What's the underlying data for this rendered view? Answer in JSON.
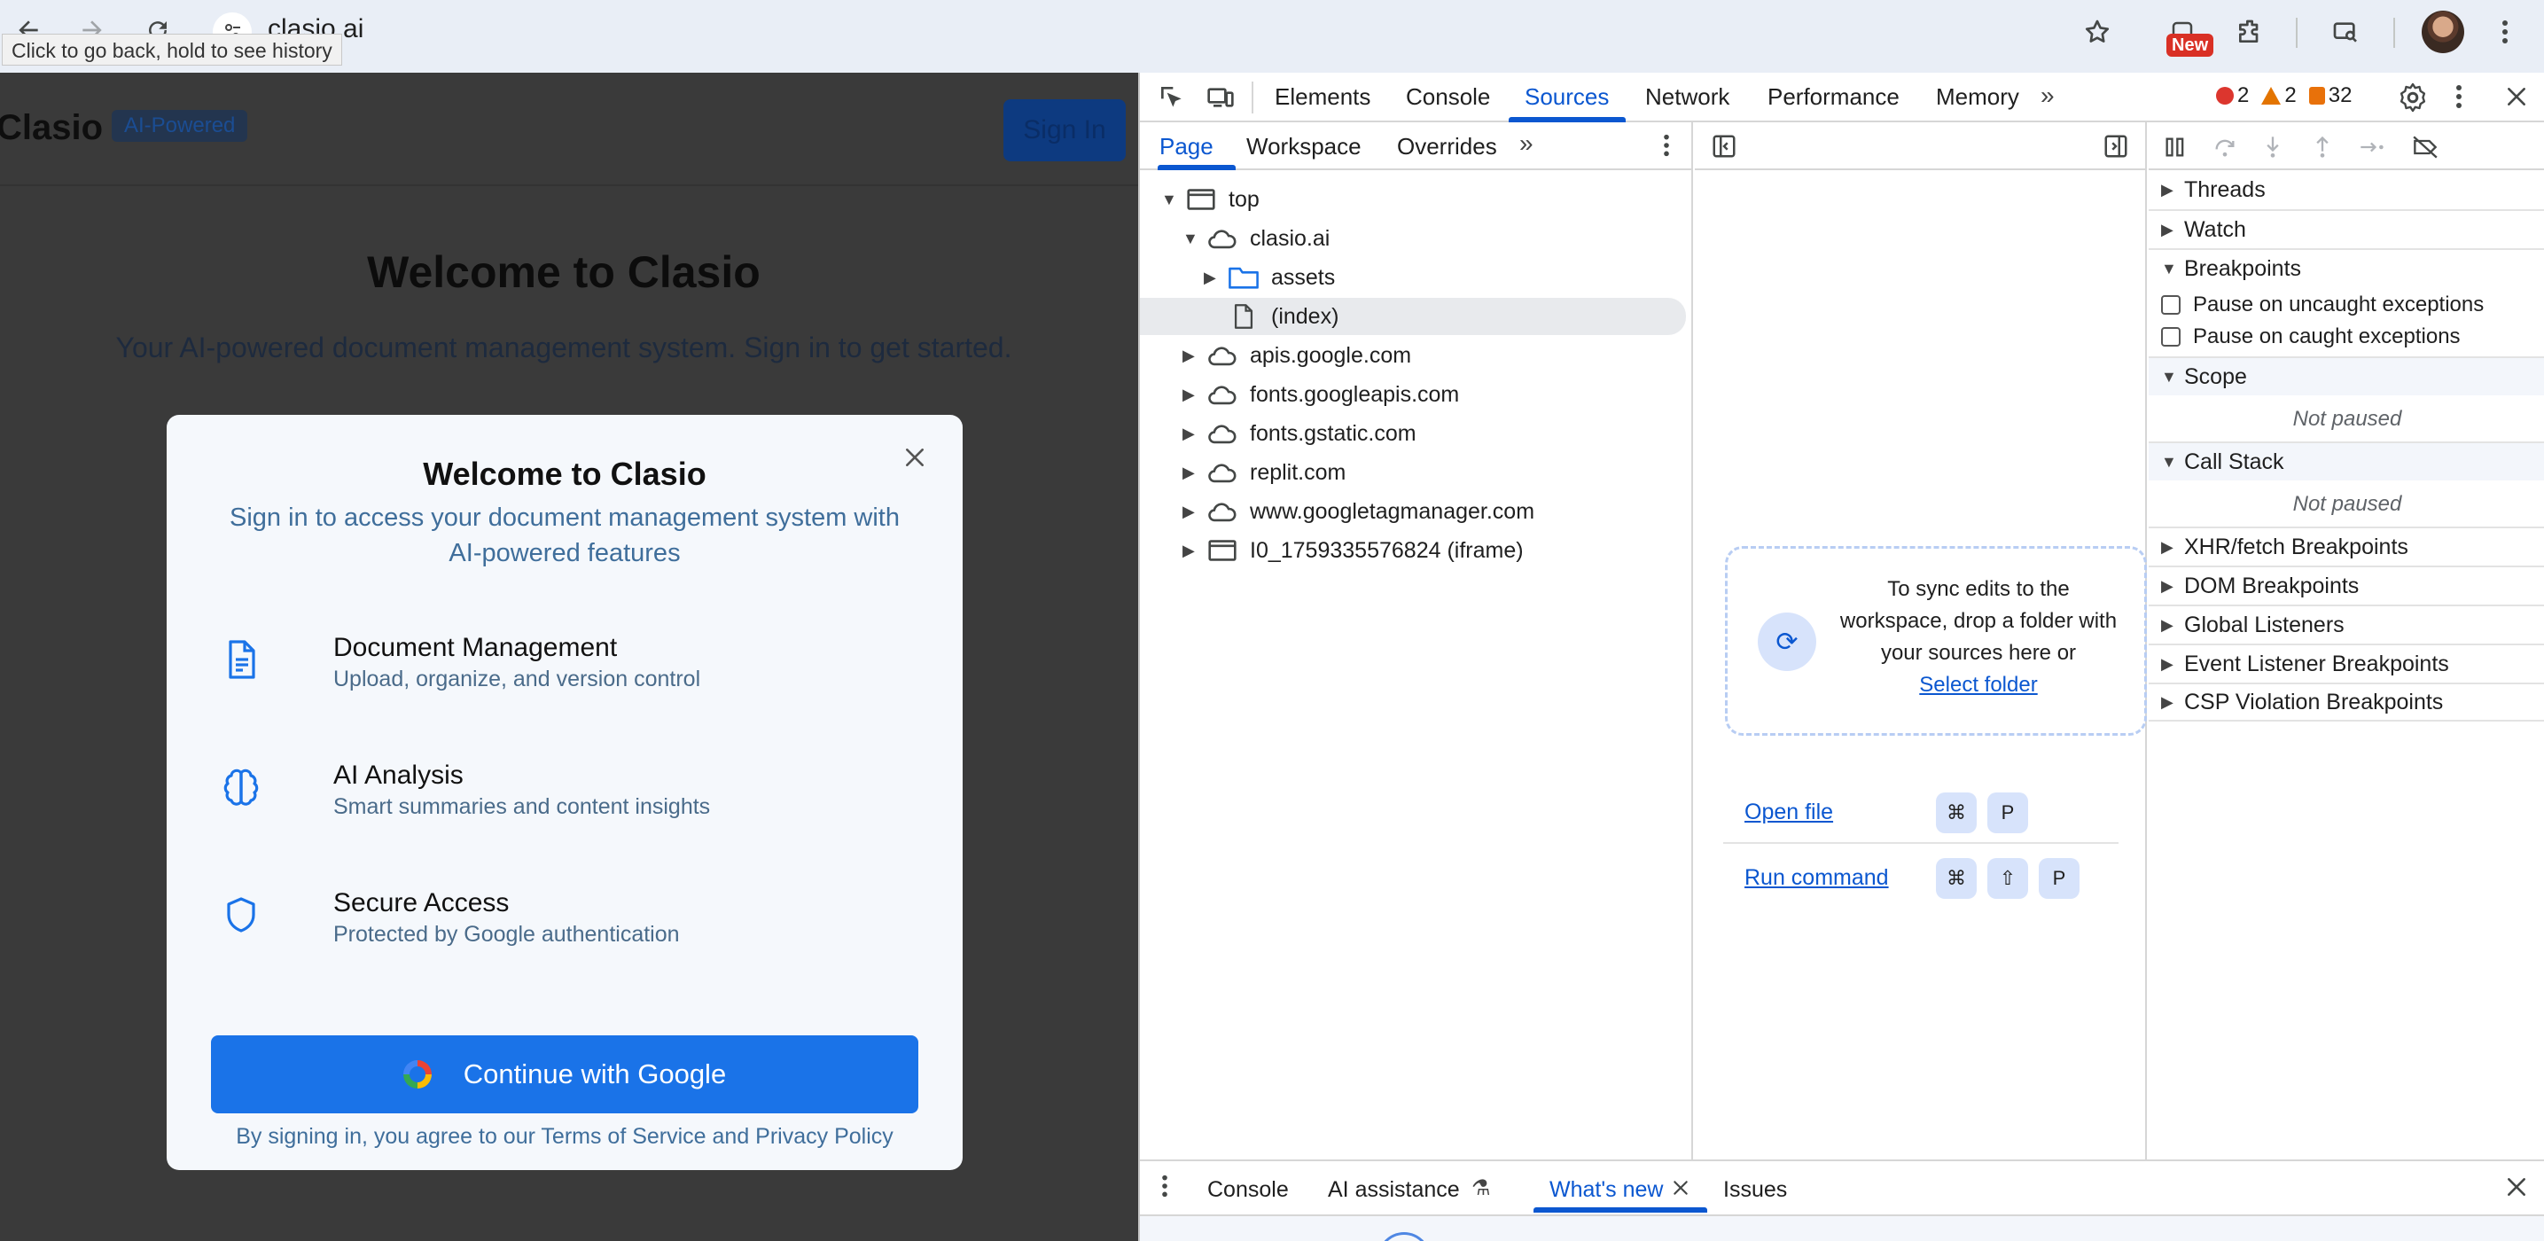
{
  "browser": {
    "url": "clasio.ai",
    "tooltip": "Click to go back, hold to see history",
    "new_badge": "New",
    "icons": [
      "back-arrow-icon",
      "forward-arrow-icon",
      "reload-icon",
      "site-info-icon",
      "bookmark-star-icon",
      "extensions-icon",
      "tab-search-icon",
      "profile-avatar",
      "kebab-menu-icon"
    ]
  },
  "page": {
    "brand": "Clasio",
    "brand_badge": "AI-Powered",
    "signin_button": "Sign In",
    "hero_title": "Welcome to Clasio",
    "hero_subtitle": "Your AI-powered document management system. Sign in to get started."
  },
  "modal": {
    "title": "Welcome to Clasio",
    "subtitle": "Sign in to access your document management system with AI-powered features",
    "features": [
      {
        "title": "Document Management",
        "desc": "Upload, organize, and version control",
        "icon": "document-icon"
      },
      {
        "title": "AI Analysis",
        "desc": "Smart summaries and content insights",
        "icon": "brain-icon"
      },
      {
        "title": "Secure Access",
        "desc": "Protected by Google authentication",
        "icon": "shield-icon"
      }
    ],
    "google_button": "Continue with Google",
    "legal": "By signing in, you agree to our Terms of Service and Privacy Policy"
  },
  "devtools": {
    "tabs": [
      "Elements",
      "Console",
      "Sources",
      "Network",
      "Performance",
      "Memory"
    ],
    "active_tab": "Sources",
    "errors": "2",
    "warnings": "2",
    "issues": "32",
    "colors": {
      "accent": "#0b57d0",
      "error": "#dc362e",
      "warning": "#e37400",
      "issue": "#e8710a"
    },
    "nav_tabs": [
      "Page",
      "Workspace",
      "Overrides"
    ],
    "tree": [
      {
        "label": "top",
        "depth": 0,
        "expanded": true,
        "icon": "frame-icon"
      },
      {
        "label": "clasio.ai",
        "depth": 1,
        "expanded": true,
        "icon": "cloud-icon"
      },
      {
        "label": "assets",
        "depth": 2,
        "expanded": false,
        "icon": "folder-icon"
      },
      {
        "label": "(index)",
        "depth": 2,
        "leaf": true,
        "icon": "file-icon",
        "selected": true
      },
      {
        "label": "apis.google.com",
        "depth": 1,
        "expanded": false,
        "icon": "cloud-icon"
      },
      {
        "label": "fonts.googleapis.com",
        "depth": 1,
        "expanded": false,
        "icon": "cloud-icon"
      },
      {
        "label": "fonts.gstatic.com",
        "depth": 1,
        "expanded": false,
        "icon": "cloud-icon"
      },
      {
        "label": "replit.com",
        "depth": 1,
        "expanded": false,
        "icon": "cloud-icon"
      },
      {
        "label": "www.googletagmanager.com",
        "depth": 1,
        "expanded": false,
        "icon": "cloud-icon"
      },
      {
        "label": "I0_1759335576824 (iframe)",
        "depth": 1,
        "expanded": false,
        "icon": "frame-icon"
      }
    ],
    "sync": {
      "text": "To sync edits to the workspace, drop a folder with your sources here or",
      "link": "Select folder"
    },
    "commands": [
      {
        "label": "Open file",
        "keys": [
          "⌘",
          "P"
        ]
      },
      {
        "label": "Run command",
        "keys": [
          "⌘",
          "⇧",
          "P"
        ]
      }
    ],
    "debugger": {
      "sections_top": [
        "Threads",
        "Watch",
        "Breakpoints"
      ],
      "checkboxes": [
        "Pause on uncaught exceptions",
        "Pause on caught exceptions"
      ],
      "scope": "Scope",
      "not_paused": "Not paused",
      "call_stack": "Call Stack",
      "sections_bottom": [
        "XHR/fetch Breakpoints",
        "DOM Breakpoints",
        "Global Listeners",
        "Event Listener Breakpoints",
        "CSP Violation Breakpoints"
      ]
    },
    "drawer": {
      "tabs": [
        "Console",
        "AI assistance",
        "What's new",
        "Issues"
      ],
      "active": "What's new"
    }
  }
}
